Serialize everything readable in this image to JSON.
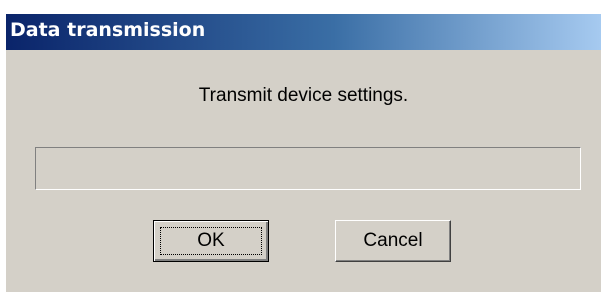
{
  "window": {
    "title": "Data transmission"
  },
  "message": "Transmit device settings.",
  "progress": {
    "fraction": 0
  },
  "buttons": {
    "ok_label": "OK",
    "cancel_label": "Cancel"
  }
}
